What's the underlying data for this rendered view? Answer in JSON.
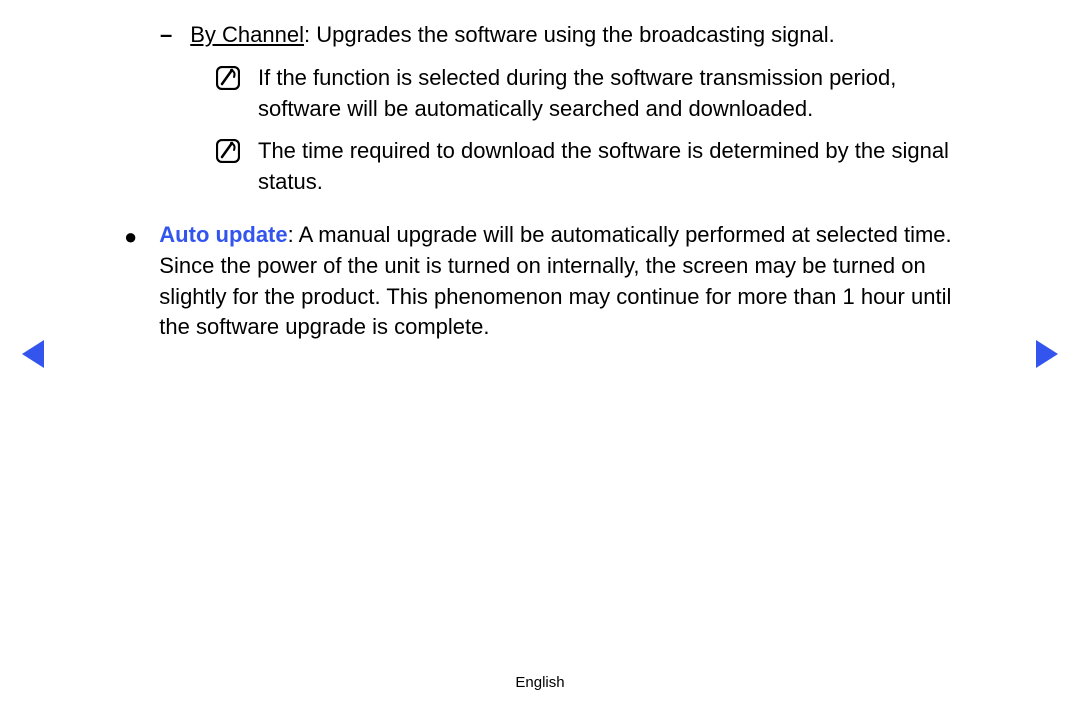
{
  "byChannel": {
    "marker": "–",
    "label": "By Channel",
    "description": ": Upgrades the software using the broadcasting signal."
  },
  "notes": [
    {
      "text": "If the function is selected during the software transmission period, software will be automatically searched and downloaded."
    },
    {
      "text": "The time required to download the software is determined by the signal status."
    }
  ],
  "autoUpdate": {
    "marker": "●",
    "label": "Auto update",
    "description": ": A manual upgrade will be automatically performed at selected time. Since the power of the unit is turned on internally, the screen may be turned on slightly for the product. This phenomenon may continue for more than 1 hour until the software upgrade is complete."
  },
  "footer": {
    "language": "English"
  }
}
